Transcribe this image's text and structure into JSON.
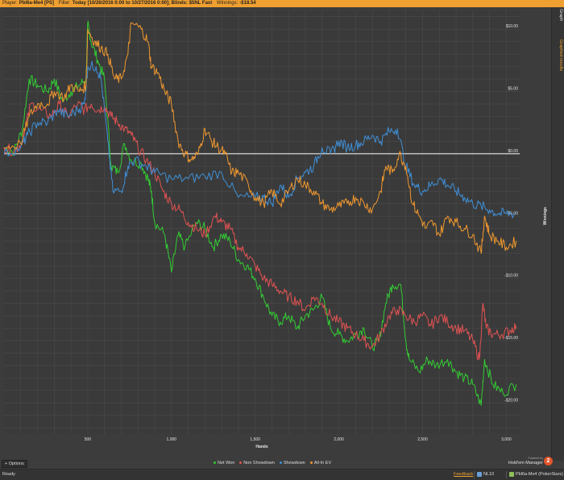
{
  "header": {
    "player_label": "Player:",
    "player_value": "Pbl6a-Me4 [PS]",
    "filter_label": "Filter:",
    "filter_value": "Today [10/26/2016 0:00 to 10/27/2016 0:00]; Blinds: $5NL Fast",
    "winnings_label": "Winnings:",
    "winnings_value": "-$18.54"
  },
  "side_tabs": [
    "Graph",
    "Graphed results"
  ],
  "options_label": "Options",
  "brand": {
    "powered_by": "Powered by",
    "name": "Hold'em Manager",
    "logo": "2"
  },
  "status": {
    "ready": "Ready",
    "feedback": "Feedback",
    "stake": "NL10",
    "player": "Pbl6a-Me4 (PokerStars)"
  },
  "colors": {
    "net_won": "#33cc33",
    "non_showdown": "#e05252",
    "showdown": "#3f8fd6",
    "all_in_ev": "#f0982f",
    "accent": "#f0a030"
  },
  "chart_data": {
    "type": "line",
    "xlabel": "Hands",
    "ylabel": "Winnings",
    "xlim": [
      0,
      3080
    ],
    "ylim": [
      -22.5,
      11.5
    ],
    "x_ticks": [
      {
        "value": 500,
        "label": "500"
      },
      {
        "value": 1000,
        "label": "1,000"
      },
      {
        "value": 1500,
        "label": "1,500"
      },
      {
        "value": 2000,
        "label": "2,000"
      },
      {
        "value": 2500,
        "label": "2,500"
      },
      {
        "value": 3000,
        "label": "3,000"
      }
    ],
    "y_ticks": [
      {
        "value": 10,
        "label": "$10.00"
      },
      {
        "value": 5,
        "label": "$5.00"
      },
      {
        "value": 0,
        "label": "$0.00"
      },
      {
        "value": -5,
        "label": "-$5.00"
      },
      {
        "value": -10,
        "label": "-$10.00"
      },
      {
        "value": -15,
        "label": "-$15.00"
      },
      {
        "value": -20,
        "label": "-$20.00"
      }
    ],
    "series": [
      {
        "name": "Net Won",
        "color_key": "net_won",
        "points": [
          [
            0,
            0.5
          ],
          [
            60,
            0.2
          ],
          [
            110,
            2
          ],
          [
            150,
            6
          ],
          [
            200,
            5.5
          ],
          [
            260,
            5
          ],
          [
            300,
            6
          ],
          [
            350,
            4.2
          ],
          [
            400,
            5
          ],
          [
            450,
            5.5
          ],
          [
            490,
            6
          ],
          [
            500,
            10.5
          ],
          [
            520,
            9
          ],
          [
            560,
            7.5
          ],
          [
            600,
            6
          ],
          [
            640,
            -1
          ],
          [
            680,
            -1.5
          ],
          [
            720,
            0.8
          ],
          [
            760,
            -0.5
          ],
          [
            820,
            -0.8
          ],
          [
            860,
            -2
          ],
          [
            880,
            -3
          ],
          [
            900,
            -5.5
          ],
          [
            960,
            -6.5
          ],
          [
            1000,
            -9.5
          ],
          [
            1040,
            -6.5
          ],
          [
            1080,
            -7.5
          ],
          [
            1150,
            -5.5
          ],
          [
            1200,
            -6
          ],
          [
            1250,
            -7.5
          ],
          [
            1300,
            -6.5
          ],
          [
            1350,
            -7
          ],
          [
            1400,
            -8.5
          ],
          [
            1450,
            -9
          ],
          [
            1500,
            -10
          ],
          [
            1550,
            -11.5
          ],
          [
            1600,
            -13
          ],
          [
            1650,
            -13.5
          ],
          [
            1700,
            -13
          ],
          [
            1750,
            -14
          ],
          [
            1800,
            -13
          ],
          [
            1850,
            -12.5
          ],
          [
            1900,
            -11.5
          ],
          [
            1950,
            -14
          ],
          [
            2000,
            -14.5
          ],
          [
            2050,
            -15
          ],
          [
            2100,
            -14.5
          ],
          [
            2150,
            -14
          ],
          [
            2200,
            -15.5
          ],
          [
            2240,
            -15
          ],
          [
            2280,
            -12
          ],
          [
            2320,
            -10.5
          ],
          [
            2370,
            -10.5
          ],
          [
            2400,
            -15
          ],
          [
            2420,
            -16.5
          ],
          [
            2480,
            -17.5
          ],
          [
            2530,
            -16.5
          ],
          [
            2580,
            -17
          ],
          [
            2650,
            -16.5
          ],
          [
            2700,
            -17.5
          ],
          [
            2750,
            -18
          ],
          [
            2800,
            -18.5
          ],
          [
            2850,
            -20.2
          ],
          [
            2870,
            -16.5
          ],
          [
            2920,
            -18.5
          ],
          [
            2980,
            -19.2
          ],
          [
            3060,
            -18.5
          ]
        ]
      },
      {
        "name": "Non Showdown",
        "color_key": "non_showdown",
        "points": [
          [
            0,
            0.5
          ],
          [
            60,
            0.2
          ],
          [
            110,
            1
          ],
          [
            160,
            4
          ],
          [
            220,
            3.5
          ],
          [
            280,
            3
          ],
          [
            330,
            4
          ],
          [
            380,
            3
          ],
          [
            440,
            4
          ],
          [
            480,
            3.5
          ],
          [
            520,
            4
          ],
          [
            560,
            3.5
          ],
          [
            600,
            3.8
          ],
          [
            640,
            3
          ],
          [
            680,
            2.5
          ],
          [
            720,
            2
          ],
          [
            760,
            1.5
          ],
          [
            800,
            0.5
          ],
          [
            850,
            -0.5
          ],
          [
            900,
            -1.5
          ],
          [
            950,
            -3
          ],
          [
            1000,
            -4
          ],
          [
            1050,
            -4.5
          ],
          [
            1100,
            -5.5
          ],
          [
            1150,
            -6
          ],
          [
            1200,
            -6.5
          ],
          [
            1260,
            -5
          ],
          [
            1300,
            -5.5
          ],
          [
            1350,
            -6
          ],
          [
            1400,
            -7.5
          ],
          [
            1450,
            -8
          ],
          [
            1500,
            -9
          ],
          [
            1550,
            -10
          ],
          [
            1600,
            -10.5
          ],
          [
            1650,
            -11
          ],
          [
            1700,
            -11.5
          ],
          [
            1750,
            -11.8
          ],
          [
            1800,
            -12.5
          ],
          [
            1850,
            -11.5
          ],
          [
            1900,
            -12
          ],
          [
            1950,
            -13
          ],
          [
            2000,
            -13.5
          ],
          [
            2050,
            -14
          ],
          [
            2100,
            -14.5
          ],
          [
            2150,
            -15
          ],
          [
            2200,
            -15.5
          ],
          [
            2250,
            -14.5
          ],
          [
            2300,
            -13
          ],
          [
            2350,
            -12.5
          ],
          [
            2400,
            -13
          ],
          [
            2450,
            -13.5
          ],
          [
            2500,
            -13
          ],
          [
            2550,
            -13.8
          ],
          [
            2600,
            -13
          ],
          [
            2650,
            -13.5
          ],
          [
            2700,
            -14
          ],
          [
            2750,
            -14.2
          ],
          [
            2800,
            -15
          ],
          [
            2840,
            -16.5
          ],
          [
            2860,
            -12
          ],
          [
            2880,
            -14
          ],
          [
            2920,
            -14.5
          ],
          [
            2970,
            -14.5
          ],
          [
            3020,
            -14.2
          ],
          [
            3060,
            -13.8
          ]
        ]
      },
      {
        "name": "Showdown",
        "color_key": "showdown",
        "points": [
          [
            0,
            0
          ],
          [
            100,
            0.5
          ],
          [
            140,
            1.5
          ],
          [
            200,
            2.5
          ],
          [
            260,
            2.5
          ],
          [
            320,
            3.5
          ],
          [
            380,
            3
          ],
          [
            440,
            3.5
          ],
          [
            480,
            4
          ],
          [
            500,
            7
          ],
          [
            550,
            7
          ],
          [
            580,
            6
          ],
          [
            620,
            1
          ],
          [
            650,
            -3
          ],
          [
            700,
            -3
          ],
          [
            740,
            -1
          ],
          [
            780,
            -0.5
          ],
          [
            850,
            -1
          ],
          [
            900,
            -1.5
          ],
          [
            1000,
            -2
          ],
          [
            1100,
            -2
          ],
          [
            1200,
            -1.8
          ],
          [
            1300,
            -1.5
          ],
          [
            1400,
            -3.5
          ],
          [
            1500,
            -3.5
          ],
          [
            1550,
            -3.5
          ],
          [
            1600,
            -4
          ],
          [
            1650,
            -2.5
          ],
          [
            1700,
            -3.5
          ],
          [
            1750,
            -2
          ],
          [
            1800,
            -1.5
          ],
          [
            1850,
            -1
          ],
          [
            1900,
            0.5
          ],
          [
            1950,
            0
          ],
          [
            2000,
            1
          ],
          [
            2050,
            0.5
          ],
          [
            2100,
            0.7
          ],
          [
            2150,
            1
          ],
          [
            2200,
            1.5
          ],
          [
            2250,
            1
          ],
          [
            2300,
            1.8
          ],
          [
            2350,
            2
          ],
          [
            2400,
            -1
          ],
          [
            2450,
            -2.5
          ],
          [
            2500,
            -3
          ],
          [
            2550,
            -2.5
          ],
          [
            2600,
            -2
          ],
          [
            2650,
            -2.5
          ],
          [
            2700,
            -3
          ],
          [
            2750,
            -3.5
          ],
          [
            2800,
            -4
          ],
          [
            2850,
            -4.2
          ],
          [
            2900,
            -4.5
          ],
          [
            2950,
            -4.8
          ],
          [
            3000,
            -4.8
          ],
          [
            3060,
            -4.8
          ]
        ]
      },
      {
        "name": "All-In EV",
        "color_key": "all_in_ev",
        "points": [
          [
            0,
            0.5
          ],
          [
            100,
            0.8
          ],
          [
            150,
            3
          ],
          [
            200,
            4
          ],
          [
            260,
            4
          ],
          [
            300,
            5
          ],
          [
            360,
            4.5
          ],
          [
            400,
            5.5
          ],
          [
            450,
            5
          ],
          [
            490,
            5.5
          ],
          [
            500,
            10
          ],
          [
            540,
            9
          ],
          [
            580,
            8.5
          ],
          [
            620,
            8
          ],
          [
            660,
            6
          ],
          [
            700,
            6
          ],
          [
            740,
            8
          ],
          [
            760,
            10.5
          ],
          [
            820,
            10
          ],
          [
            860,
            9
          ],
          [
            880,
            7
          ],
          [
            920,
            6.5
          ],
          [
            960,
            5
          ],
          [
            1000,
            4
          ],
          [
            1040,
            1
          ],
          [
            1080,
            0
          ],
          [
            1120,
            -0.5
          ],
          [
            1160,
            0
          ],
          [
            1200,
            2
          ],
          [
            1240,
            1
          ],
          [
            1280,
            0.5
          ],
          [
            1320,
            0
          ],
          [
            1360,
            -1.5
          ],
          [
            1400,
            -1.5
          ],
          [
            1460,
            -2.5
          ],
          [
            1500,
            -3.5
          ],
          [
            1550,
            -4
          ],
          [
            1600,
            -3
          ],
          [
            1650,
            -4
          ],
          [
            1700,
            -3
          ],
          [
            1750,
            -2
          ],
          [
            1800,
            -2.5
          ],
          [
            1850,
            -3
          ],
          [
            1900,
            -4
          ],
          [
            1950,
            -4.5
          ],
          [
            2000,
            -4.2
          ],
          [
            2050,
            -4
          ],
          [
            2100,
            -3.5
          ],
          [
            2150,
            -4
          ],
          [
            2200,
            -4.5
          ],
          [
            2250,
            -3
          ],
          [
            2280,
            -1
          ],
          [
            2320,
            -1.5
          ],
          [
            2360,
            0
          ],
          [
            2400,
            -1
          ],
          [
            2440,
            -4
          ],
          [
            2480,
            -5
          ],
          [
            2520,
            -6
          ],
          [
            2560,
            -5.5
          ],
          [
            2600,
            -6.5
          ],
          [
            2650,
            -5
          ],
          [
            2700,
            -5.5
          ],
          [
            2750,
            -6
          ],
          [
            2800,
            -6.5
          ],
          [
            2850,
            -8
          ],
          [
            2870,
            -5
          ],
          [
            2900,
            -6.5
          ],
          [
            2950,
            -7
          ],
          [
            3000,
            -7.5
          ],
          [
            3060,
            -7
          ]
        ]
      }
    ],
    "grid": true,
    "legend": "bottom-center"
  }
}
